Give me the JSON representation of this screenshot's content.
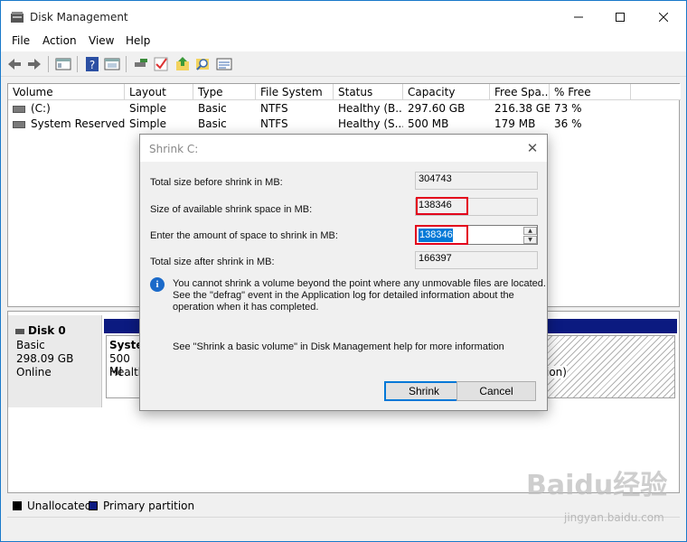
{
  "window": {
    "title": "Disk Management",
    "controls": {
      "minimize": "—",
      "maximize": "☐",
      "close": "✕"
    }
  },
  "menu": {
    "items": [
      "File",
      "Action",
      "View",
      "Help"
    ]
  },
  "toolbar": {
    "icons": [
      "back-arrow-icon",
      "forward-arrow-icon",
      "show-hide-console-tree-icon",
      "help-icon",
      "properties-icon",
      "connect-disk-icon",
      "check-icon",
      "export-icon",
      "search-icon",
      "settings-icon"
    ]
  },
  "volume_list": {
    "columns": [
      "Volume",
      "Layout",
      "Type",
      "File System",
      "Status",
      "Capacity",
      "Free Spa...",
      "% Free"
    ],
    "rows": [
      {
        "volume": "(C:)",
        "layout": "Simple",
        "type": "Basic",
        "file_system": "NTFS",
        "status": "Healthy (B...",
        "capacity": "297.60 GB",
        "free_space": "216.38 GB",
        "percent_free": "73 %"
      },
      {
        "volume": "System Reserved",
        "layout": "Simple",
        "type": "Basic",
        "file_system": "NTFS",
        "status": "Healthy (S...",
        "capacity": "500 MB",
        "free_space": "179 MB",
        "percent_free": "36 %"
      }
    ]
  },
  "disk_view": {
    "disk": {
      "name": "Disk 0",
      "type": "Basic",
      "size": "298.09 GB",
      "state": "Online"
    },
    "partitions": [
      {
        "name": "Syster",
        "size": "500 MI",
        "status": "Health"
      },
      {
        "status_tail": "ion)"
      }
    ]
  },
  "legend": {
    "items": [
      {
        "label": "Unallocated",
        "color": "#000000"
      },
      {
        "label": "Primary partition",
        "color": "#0b1a80"
      }
    ]
  },
  "dialog": {
    "title": "Shrink C:",
    "close": "✕",
    "fields": {
      "total_before_label": "Total size before shrink in MB:",
      "total_before_value": "304743",
      "available_label": "Size of available shrink space in MB:",
      "available_value": "138346",
      "amount_label": "Enter the amount of space to shrink in MB:",
      "amount_value": "138346",
      "total_after_label": "Total size after shrink in MB:",
      "total_after_value": "166397"
    },
    "info_icon": "i",
    "note_lines": [
      "You cannot shrink a volume beyond the point where any unmovable files are located.",
      "See the \"defrag\" event in the Application log for detailed information about the",
      "operation when it has completed."
    ],
    "help_text": "See \"Shrink a basic volume\" in Disk Management help for more information",
    "buttons": {
      "shrink": "Shrink",
      "cancel": "Cancel"
    },
    "highlight_color": "#e3001b"
  },
  "watermark": {
    "text": "Baidu经验",
    "url": "jingyan.baidu.com"
  }
}
